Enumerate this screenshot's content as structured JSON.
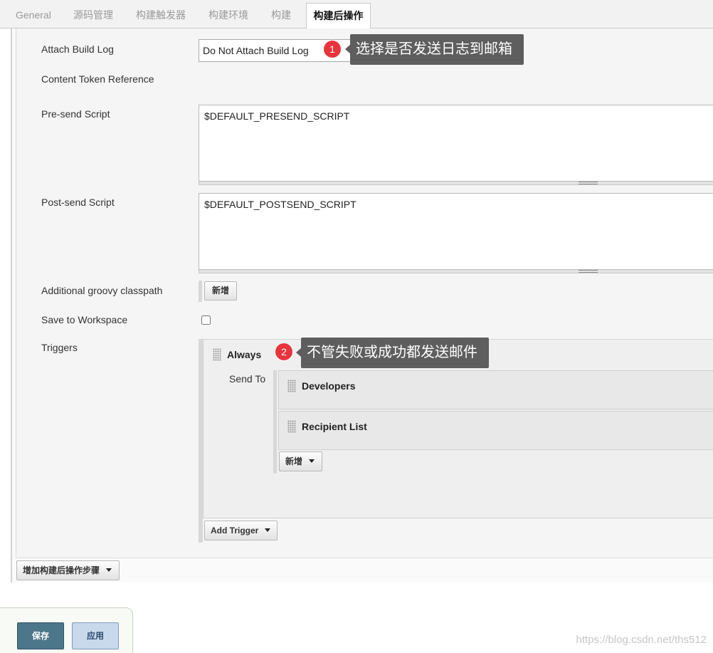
{
  "tabs": [
    {
      "label": "General",
      "active": false
    },
    {
      "label": "源码管理",
      "active": false
    },
    {
      "label": "构建触发器",
      "active": false
    },
    {
      "label": "构建环境",
      "active": false
    },
    {
      "label": "构建",
      "active": false
    },
    {
      "label": "构建后操作",
      "active": true
    }
  ],
  "form": {
    "attach_build_log": {
      "label": "Attach Build Log",
      "value": "Do Not Attach Build Log"
    },
    "content_token_reference": {
      "label": "Content Token Reference"
    },
    "pre_send_script": {
      "label": "Pre-send Script",
      "value": "$DEFAULT_PRESEND_SCRIPT"
    },
    "post_send_script": {
      "label": "Post-send Script",
      "value": "$DEFAULT_POSTSEND_SCRIPT"
    },
    "groovy_classpath": {
      "label": "Additional groovy classpath",
      "add_label": "新增"
    },
    "save_to_workspace": {
      "label": "Save to Workspace",
      "checked": false
    },
    "triggers": {
      "label": "Triggers",
      "items": [
        {
          "name": "Always",
          "send_to_label": "Send To",
          "recipients": [
            {
              "name": "Developers"
            },
            {
              "name": "Recipient List"
            }
          ],
          "add_label": "新增"
        }
      ],
      "add_trigger_label": "Add Trigger"
    }
  },
  "add_post_build_step_label": "增加构建后操作步骤",
  "annotations": [
    {
      "number": "1",
      "text": "选择是否发送日志到邮箱"
    },
    {
      "number": "2",
      "text": "不管失败或成功都发送邮件"
    }
  ],
  "footer": {
    "save_label": "保存",
    "apply_label": "应用"
  },
  "watermark": "https://blog.csdn.net/ths512",
  "icons": {
    "dropdown": "caret-down-icon",
    "drag": "drag-handle-icon"
  },
  "colors": {
    "badge": "#e8343c",
    "tooltip": "#5e5e5e",
    "save_button": "#4c768a",
    "apply_button": "#c8d9ec"
  }
}
